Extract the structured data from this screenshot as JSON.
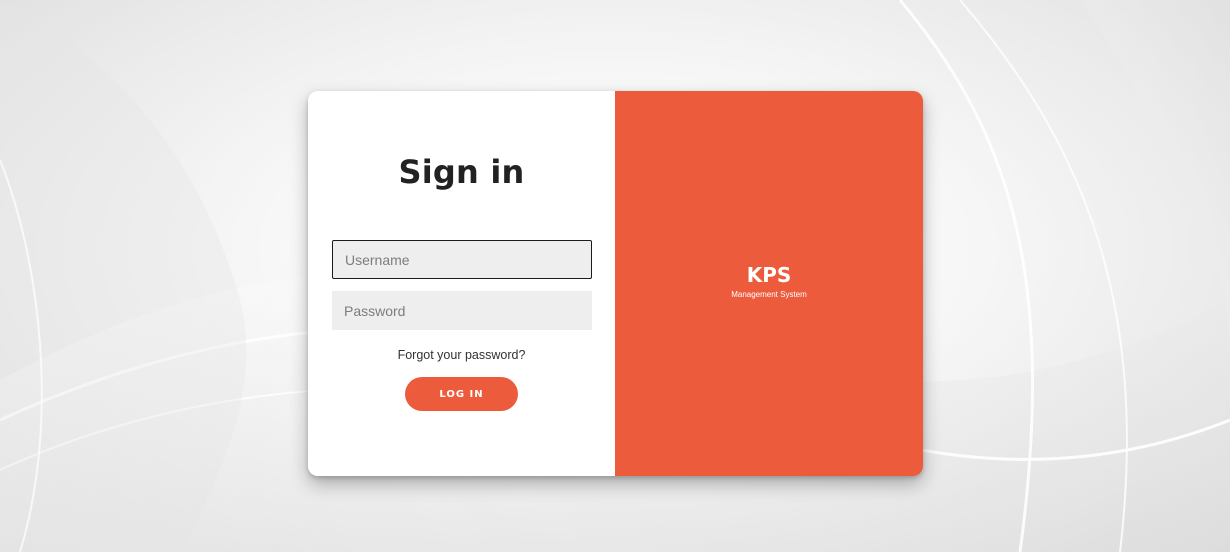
{
  "signin": {
    "title": "Sign in",
    "username_placeholder": "Username",
    "password_placeholder": "Password",
    "forgot_link": "Forgot your password?",
    "login_label": "LOG IN"
  },
  "brand": {
    "name": "KPS",
    "subtitle": "Management System"
  },
  "colors": {
    "accent": "#ec5b3b",
    "title_text": "#222222",
    "input_bg": "#eeeeee"
  }
}
